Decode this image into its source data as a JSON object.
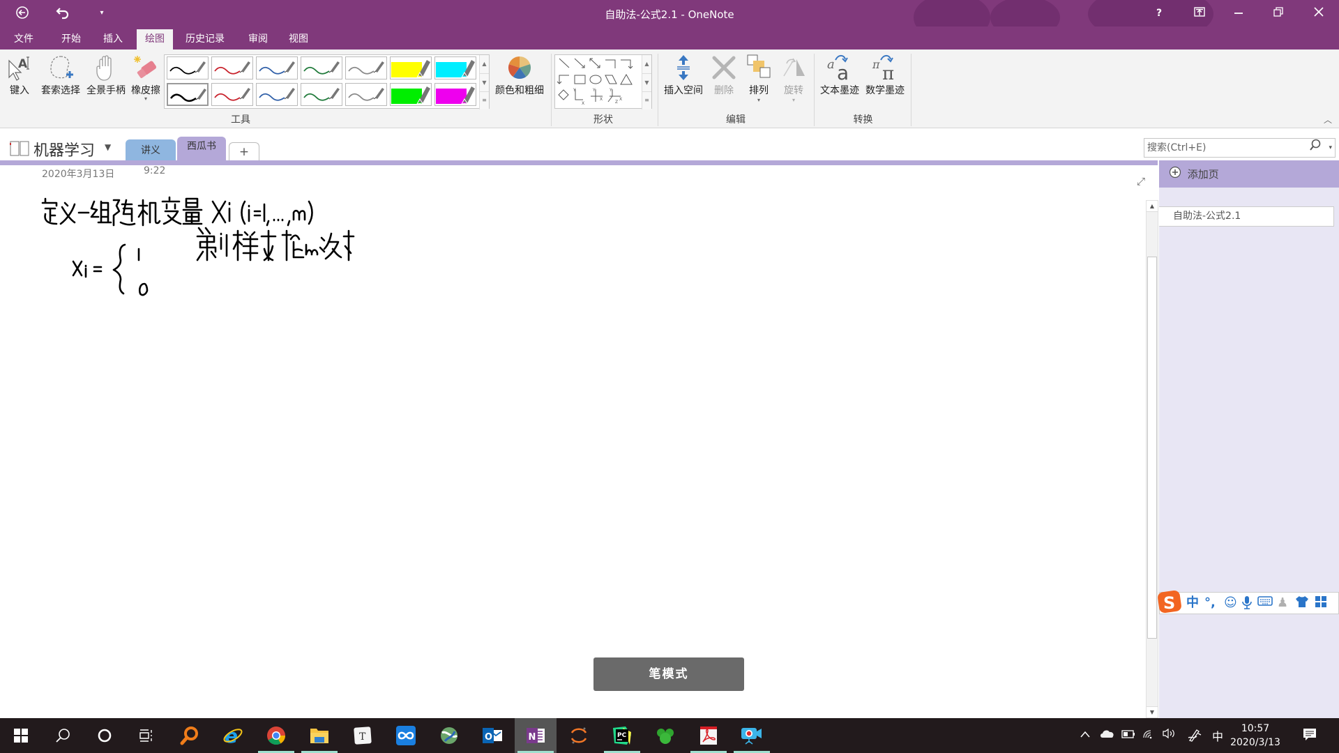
{
  "window": {
    "title": "自助法-公式2.1 - OneNote",
    "controls": {
      "help": "?",
      "fullscreen": "⇱",
      "minimize": "—",
      "restore": "❐",
      "close": "✕"
    }
  },
  "quick_access": {
    "back": "back-icon",
    "undo": "undo-icon",
    "customize": "customize-icon"
  },
  "menu_tabs": [
    {
      "label": "文件",
      "active": false
    },
    {
      "label": "开始",
      "active": false
    },
    {
      "label": "插入",
      "active": false
    },
    {
      "label": "绘图",
      "active": true
    },
    {
      "label": "历史记录",
      "active": false
    },
    {
      "label": "审阅",
      "active": false
    },
    {
      "label": "视图",
      "active": false
    }
  ],
  "ribbon": {
    "tools": {
      "type": "键入",
      "lasso": "套索选择",
      "pan": "全景手柄",
      "eraser": "橡皮擦",
      "group_label": "工具"
    },
    "pens_row1": [
      {
        "color": "#000000",
        "kind": "pen"
      },
      {
        "color": "#c8202a",
        "kind": "pen"
      },
      {
        "color": "#2f5fa8",
        "kind": "pen"
      },
      {
        "color": "#1f7a3a",
        "kind": "pen"
      },
      {
        "color": "#888888",
        "kind": "pen"
      },
      {
        "color": "#ffff00",
        "kind": "highlighter"
      },
      {
        "color": "#00eeff",
        "kind": "highlighter"
      }
    ],
    "pens_row2": [
      {
        "color": "#000000",
        "kind": "pen",
        "selected": true
      },
      {
        "color": "#c8202a",
        "kind": "pen"
      },
      {
        "color": "#2f5fa8",
        "kind": "pen"
      },
      {
        "color": "#1f7a3a",
        "kind": "pen"
      },
      {
        "color": "#888888",
        "kind": "pen"
      },
      {
        "color": "#00ee00",
        "kind": "highlighter"
      },
      {
        "color": "#ee00ee",
        "kind": "highlighter"
      }
    ],
    "color_thickness": "颜色和粗细",
    "shapes_label": "形状",
    "edit": {
      "insert_space": "插入空间",
      "delete": "删除",
      "arrange": "排列",
      "rotate": "旋转",
      "group_label": "编辑"
    },
    "convert": {
      "ink_to_text": "文本墨迹",
      "ink_to_math": "数学墨迹",
      "group_label": "转换"
    }
  },
  "notebook": {
    "name": "机器学习",
    "sections": [
      {
        "label": "讲义",
        "color": "#8fb6e0",
        "active": false
      },
      {
        "label": "西瓜书",
        "color": "#b4a8d8",
        "active": true
      },
      {
        "label": "+",
        "color": "#ffffff",
        "active": false
      }
    ],
    "search_placeholder": "搜索(Ctrl+E)"
  },
  "page": {
    "date": "2020年3月13日",
    "time": "9:22",
    "ink_lines": [
      "定义一组随机变量 Xi (i=1, ..., m)",
      "Xi = { 1  第i个样本在m次中",
      "       0"
    ]
  },
  "page_list": {
    "add_page": "添加页",
    "pages": [
      "自助法-公式2.1"
    ]
  },
  "pen_mode_toast": "笔模式",
  "ime": {
    "mode": "中",
    "punct": "°,",
    "icons": [
      "sogou-logo-icon",
      "emoji-icon",
      "microphone-icon",
      "keyboard-icon",
      "user-icon",
      "skin-icon",
      "toolbox-icon"
    ]
  },
  "taskbar": {
    "apps": [
      "start",
      "search",
      "cortana",
      "task-view",
      "everything",
      "internet-explorer",
      "chrome",
      "file-explorer",
      "typora",
      "app-infinity",
      "app-globe",
      "outlook",
      "onenote",
      "jupyter",
      "pycharm",
      "app-green",
      "acrobat",
      "screen-recorder"
    ],
    "ime_indicator": "中",
    "time": "10:57",
    "date": "2020/3/13"
  }
}
